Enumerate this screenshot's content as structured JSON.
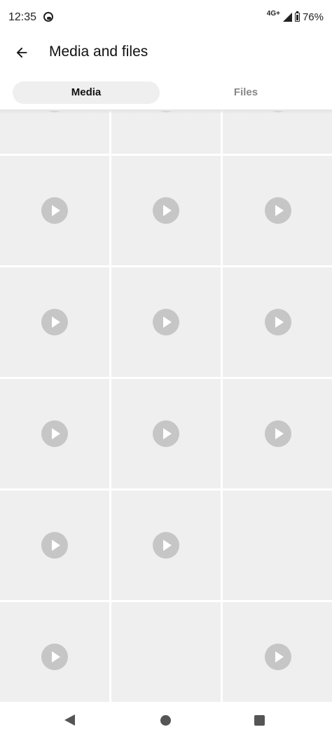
{
  "status_bar": {
    "time": "12:35",
    "network": "4G+",
    "battery": "76%"
  },
  "header": {
    "title": "Media and files"
  },
  "tabs": [
    {
      "label": "Media",
      "selected": true
    },
    {
      "label": "Files",
      "selected": false
    }
  ],
  "media_grid": {
    "cells": [
      {
        "type": "video"
      },
      {
        "type": "video"
      },
      {
        "type": "video"
      },
      {
        "type": "video"
      },
      {
        "type": "video"
      },
      {
        "type": "video"
      },
      {
        "type": "video"
      },
      {
        "type": "video"
      },
      {
        "type": "video"
      },
      {
        "type": "video"
      },
      {
        "type": "video"
      },
      {
        "type": "video"
      },
      {
        "type": "video"
      },
      {
        "type": "video"
      },
      {
        "type": "image"
      },
      {
        "type": "video"
      },
      {
        "type": "image"
      },
      {
        "type": "video"
      }
    ]
  },
  "colors": {
    "placeholder": "#efefef",
    "play_icon": "#c6c6c6",
    "selected_tab": "#efefef"
  }
}
